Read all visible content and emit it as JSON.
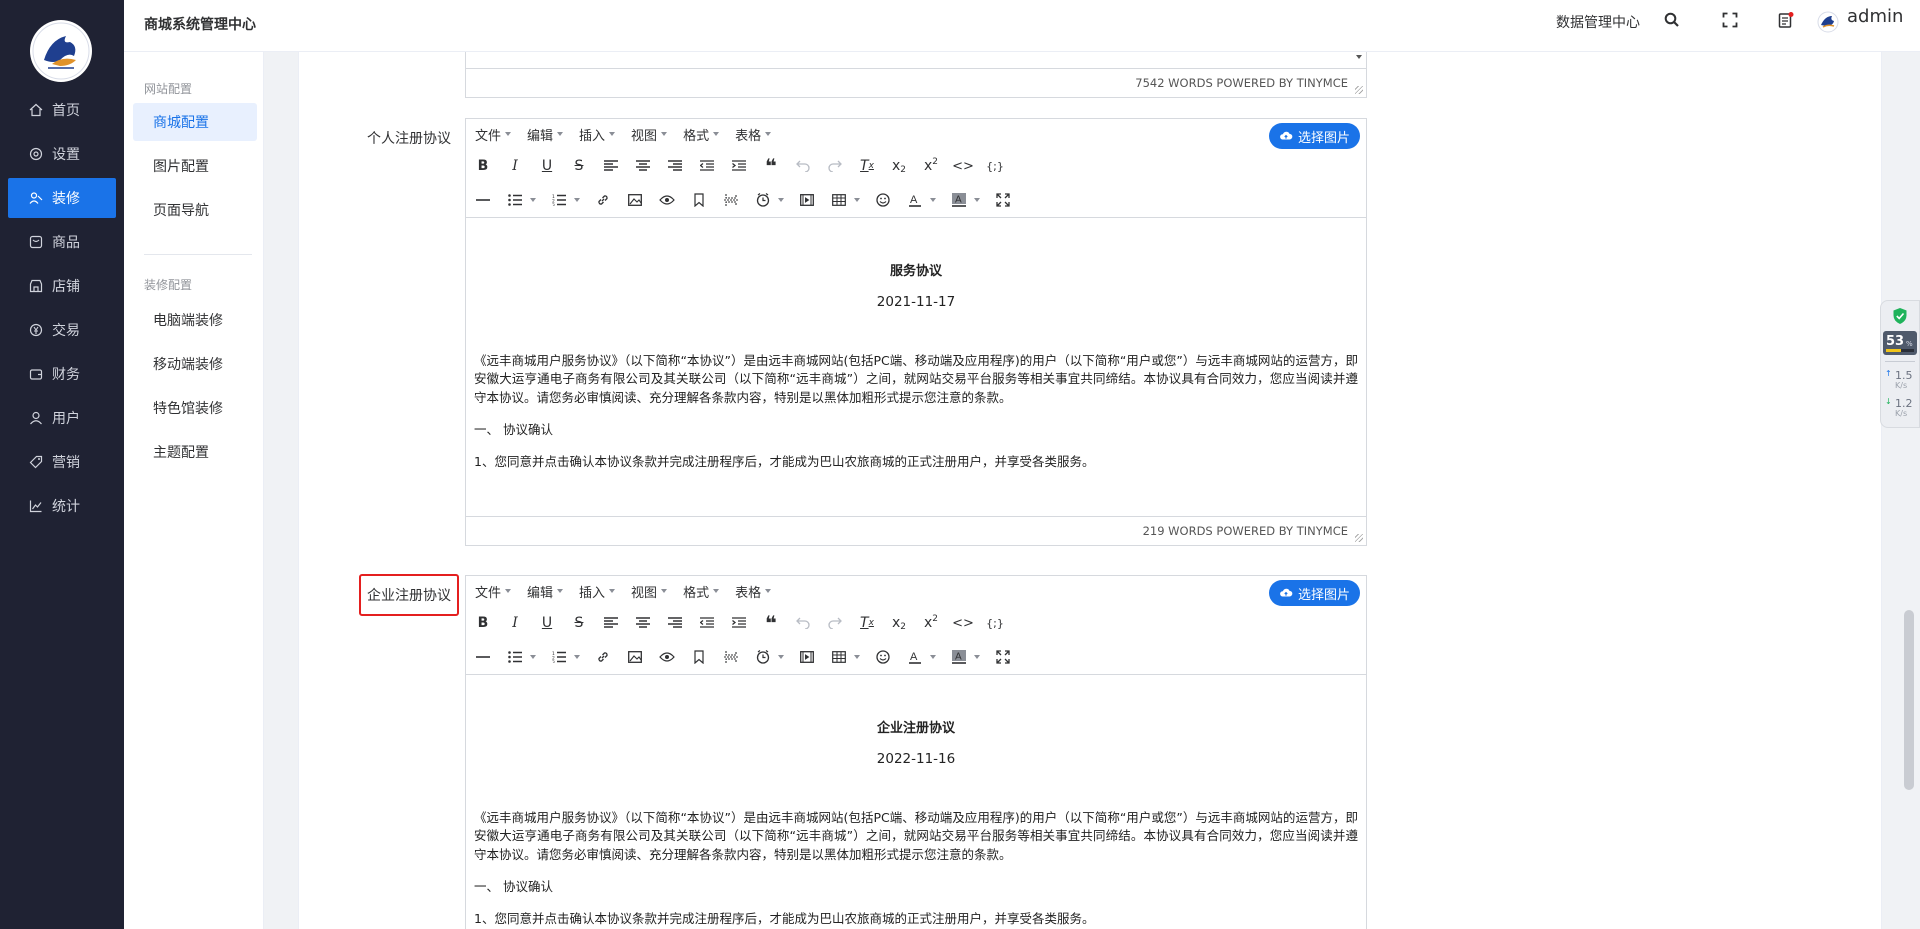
{
  "header": {
    "title": "商城系统管理中心",
    "data_center": "数据管理中心",
    "user": "admin"
  },
  "sidebar": {
    "items": [
      {
        "label": "首页",
        "icon": "home-icon"
      },
      {
        "label": "设置",
        "icon": "gear-icon"
      },
      {
        "label": "装修",
        "icon": "decorate-icon",
        "active": true
      },
      {
        "label": "商品",
        "icon": "goods-icon"
      },
      {
        "label": "店铺",
        "icon": "shop-icon"
      },
      {
        "label": "交易",
        "icon": "trade-icon"
      },
      {
        "label": "财务",
        "icon": "wallet-icon"
      },
      {
        "label": "用户",
        "icon": "user-icon"
      },
      {
        "label": "营销",
        "icon": "tag-icon"
      },
      {
        "label": "统计",
        "icon": "chart-icon"
      }
    ]
  },
  "subnav": {
    "group1": "网站配置",
    "group1_items": [
      "商城配置",
      "图片配置",
      "页面导航"
    ],
    "group2": "装修配置",
    "group2_items": [
      "电脑端装修",
      "移动端装修",
      "特色馆装修",
      "主题配置"
    ]
  },
  "top_editor": {
    "status": "7542 WORDS POWERED BY TINYMCE"
  },
  "menubar": [
    "文件",
    "编辑",
    "插入",
    "视图",
    "格式",
    "表格"
  ],
  "pick_image": "选择图片",
  "personal": {
    "label": "个人注册协议",
    "doc_title": "服务协议",
    "doc_date": "2021-11-17",
    "p1": "《远丰商城用户服务协议》（以下简称“本协议”）是由远丰商城网站(包括PC端、移动端及应用程序)的用户（以下简称“用户或您”）与远丰商城网站的运营方，即安徽大运亨通电子商务有限公司及其关联公司（以下简称“远丰商城”）之间，就网站交易平台服务等相关事宜共同缔结。本协议具有合同效力，您应当阅读并遵守本协议。请您务必审慎阅读、充分理解各条款内容，特别是以黑体加粗形式提示您注意的条款。",
    "p2": "一、 协议确认",
    "p3": "1、您同意并点击确认本协议条款并完成注册程序后，才能成为巴山农旅商城的正式注册用户，并享受各类服务。",
    "status": "219 WORDS POWERED BY TINYMCE"
  },
  "enterprise": {
    "label": "企业注册协议",
    "doc_title": "企业注册协议",
    "doc_date": "2022-11-16",
    "p1": "《远丰商城用户服务协议》（以下简称“本协议”）是由远丰商城网站(包括PC端、移动端及应用程序)的用户（以下简称“用户或您”）与远丰商城网站的运营方，即安徽大运亨通电子商务有限公司及其关联公司（以下简称“远丰商城”）之间，就网站交易平台服务等相关事宜共同缔结。本协议具有合同效力，您应当阅读并遵守本协议。请您务必审慎阅读、充分理解各条款内容，特别是以黑体加粗形式提示您注意的条款。",
    "p2": "一、 协议确认",
    "p3": "1、您同意并点击确认本协议条款并完成注册程序后，才能成为巴山农旅商城的正式注册用户，并享受各类服务。"
  },
  "widget": {
    "percent": "53",
    "up": "1.5",
    "down": "1.2",
    "unit": "K/s"
  },
  "colors": {
    "sidebar_bg": "#1f2233",
    "accent": "#1a73e8",
    "highlight": "#e41f1f"
  }
}
